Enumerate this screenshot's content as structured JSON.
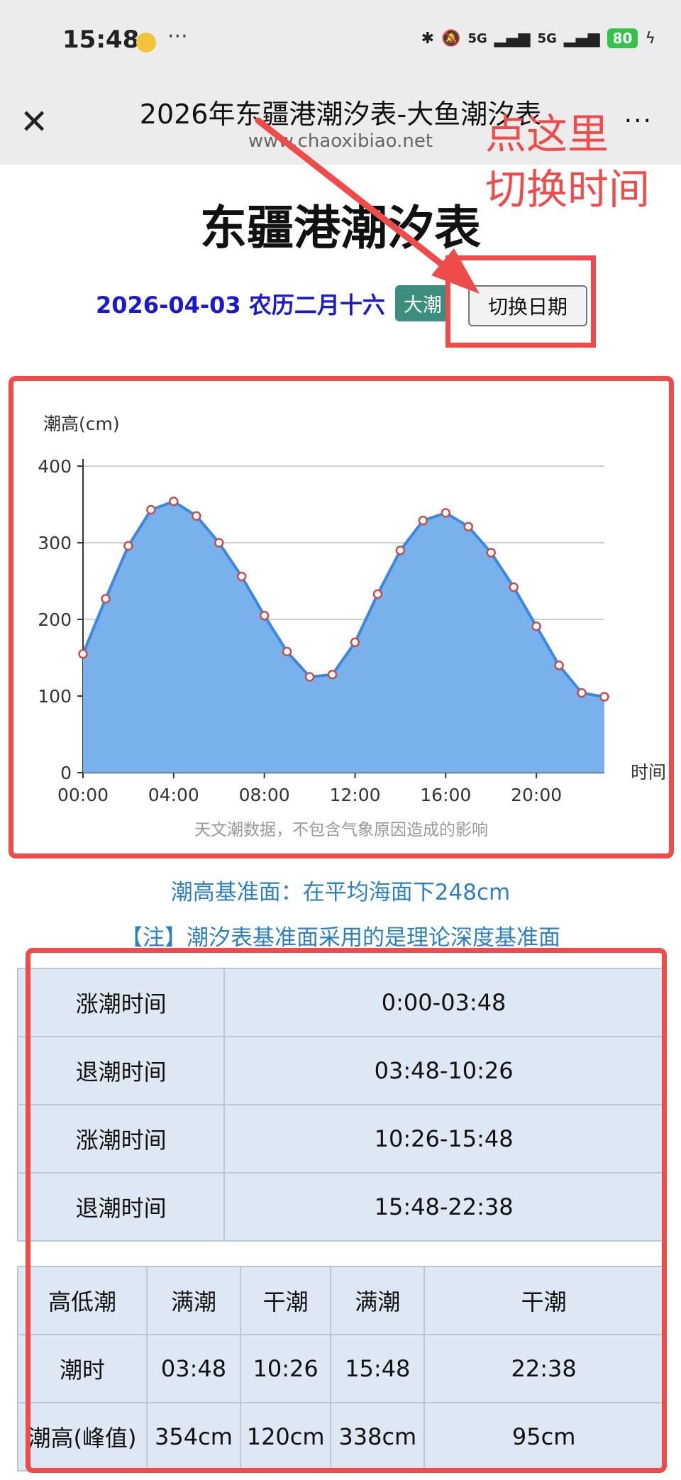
{
  "status": {
    "time": "15:48",
    "dots": "···",
    "net1": "5G",
    "net2": "5G",
    "battery": "80"
  },
  "header": {
    "close": "✕",
    "title": "2026年东疆港潮汐表-大鱼潮汐表",
    "url": "www.chaoxibiao.net",
    "more": "···"
  },
  "annotation": {
    "line1": "点这里",
    "line2": "切换时间"
  },
  "heading": "东疆港潮汐表",
  "date": {
    "text": "2026-04-03 农历二月十六",
    "badge": "大潮",
    "switch_button": "切换日期"
  },
  "chart_data": {
    "type": "area",
    "ylabel": "潮高(cm)",
    "xlabel": "时间",
    "ylim": [
      0,
      400
    ],
    "y_ticks": [
      "0",
      "100",
      "200",
      "300",
      "400"
    ],
    "x_tick_labels": [
      "00:00",
      "04:00",
      "08:00",
      "12:00",
      "16:00",
      "20:00"
    ],
    "x_hours": [
      0,
      1,
      2,
      3,
      4,
      5,
      6,
      7,
      8,
      9,
      10,
      11,
      12,
      13,
      14,
      15,
      16,
      17,
      18,
      19,
      20,
      21,
      22,
      23
    ],
    "values": [
      155,
      227,
      296,
      343,
      354,
      335,
      300,
      256,
      205,
      158,
      125,
      128,
      170,
      233,
      290,
      329,
      339,
      321,
      287,
      242,
      191,
      140,
      104,
      99
    ],
    "footnote": "天文潮数据，不包含气象原因造成的影响",
    "fill_color": "#78b1ec",
    "line_color": "#3f87dc",
    "grid": true
  },
  "datum_note": "潮高基准面：在平均海面下248cm",
  "theory_note": "【注】潮汐表基准面采用的是理论深度基准面",
  "periods": [
    {
      "label": "涨潮时间",
      "value": "0:00-03:48"
    },
    {
      "label": "退潮时间",
      "value": "03:48-10:26"
    },
    {
      "label": "涨潮时间",
      "value": "10:26-15:48"
    },
    {
      "label": "退潮时间",
      "value": "15:48-22:38"
    }
  ],
  "events": {
    "rows": [
      [
        "高低潮",
        "满潮",
        "干潮",
        "满潮",
        "干潮"
      ],
      [
        "潮时",
        "03:48",
        "10:26",
        "15:48",
        "22:38"
      ],
      [
        "潮高(峰值)",
        "354cm",
        "120cm",
        "338cm",
        "95cm"
      ]
    ]
  }
}
